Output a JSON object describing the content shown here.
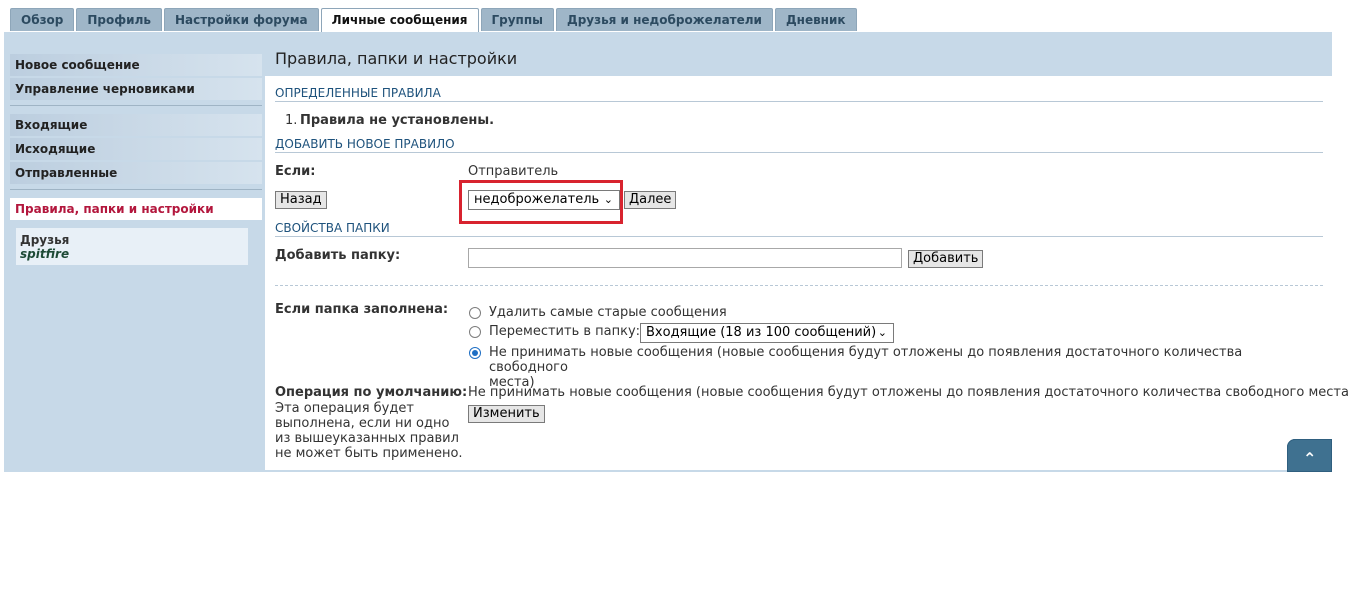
{
  "tabs": [
    {
      "label": "Обзор"
    },
    {
      "label": "Профиль"
    },
    {
      "label": "Настройки форума"
    },
    {
      "label": "Личные сообщения"
    },
    {
      "label": "Группы"
    },
    {
      "label": "Друзья и недоброжелатели"
    },
    {
      "label": "Дневник"
    }
  ],
  "page_title": "Правила, папки и настройки",
  "sidebar": {
    "group1": [
      "Новое сообщение",
      "Управление черновиками"
    ],
    "group2": [
      "Входящие",
      "Исходящие",
      "Отправленные"
    ],
    "active": "Правила, папки и настройки",
    "friends_label": "Друзья",
    "friend_name": "spitfire"
  },
  "rules": {
    "heading": "ОПРЕДЕЛЕННЫЕ ПРАВИЛА",
    "item_number": "1.",
    "empty_text": "Правила не установлены."
  },
  "add_rule": {
    "heading": "ДОБАВИТЬ НОВОЕ ПРАВИЛО",
    "if_label": "Если:",
    "sender_text": "Отправитель",
    "back_button": "Назад",
    "select_value": "недоброжелатель",
    "next_button": "Далее"
  },
  "folder_props": {
    "heading": "СВОЙСТВА ПАПКИ",
    "add_label": "Добавить папку:",
    "add_placeholder": "",
    "add_button": "Добавить",
    "full_label": "Если папка заполнена:",
    "option_delete": "Удалить самые старые сообщения",
    "option_move": "Переместить в папку:",
    "move_select_value": "Входящие (18 из 100 сообщений)",
    "option_hold_line1": "Не принимать новые сообщения (новые сообщения будут отложены до появления достаточного количества свободного",
    "option_hold_line2": "места)",
    "default_label": "Операция по умолчанию:",
    "default_desc_1": "Эта операция будет",
    "default_desc_2": "выполнена, если ни одно",
    "default_desc_3": "из вышеуказанных правил",
    "default_desc_4": "не может быть применено.",
    "default_value": "Не принимать новые сообщения (новые сообщения будут отложены до появления достаточного количества свободного места)",
    "change_button": "Изменить"
  },
  "colors": {
    "panel": "#c7d9e8",
    "heading": "#1e527c",
    "active_nav": "#b3173d",
    "highlight": "#d8232f"
  }
}
